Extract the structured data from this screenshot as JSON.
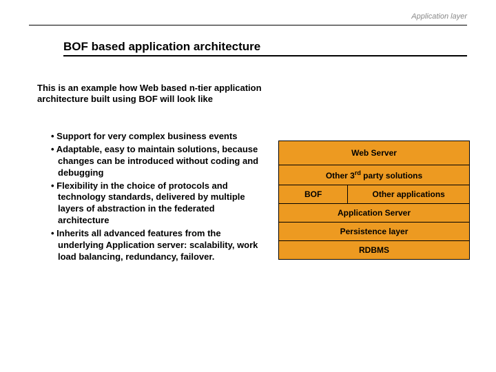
{
  "header": {
    "app_layer": "Application layer"
  },
  "title": "BOF based application architecture",
  "intro": "This is an example how Web based n-tier application architecture built using BOF will look like",
  "bullets": [
    "Support for very complex business events",
    "Adaptable, easy to maintain solutions, because changes can be introduced without coding and debugging",
    "Flexibility in the choice of protocols and technology standards, delivered by multiple layers of abstraction in the federated architecture",
    "Inherits all advanced features from the underlying Application server: scalability, work load balancing, redundancy, failover."
  ],
  "diagram": {
    "web_server": "Web Server",
    "third_party_pre": "Other 3",
    "third_party_sup": "rd",
    "third_party_post": " party solutions",
    "bof": "BOF",
    "other_apps": "Other applications",
    "app_server": "Application Server",
    "persistence": "Persistence layer",
    "rdbms": "RDBMS"
  }
}
